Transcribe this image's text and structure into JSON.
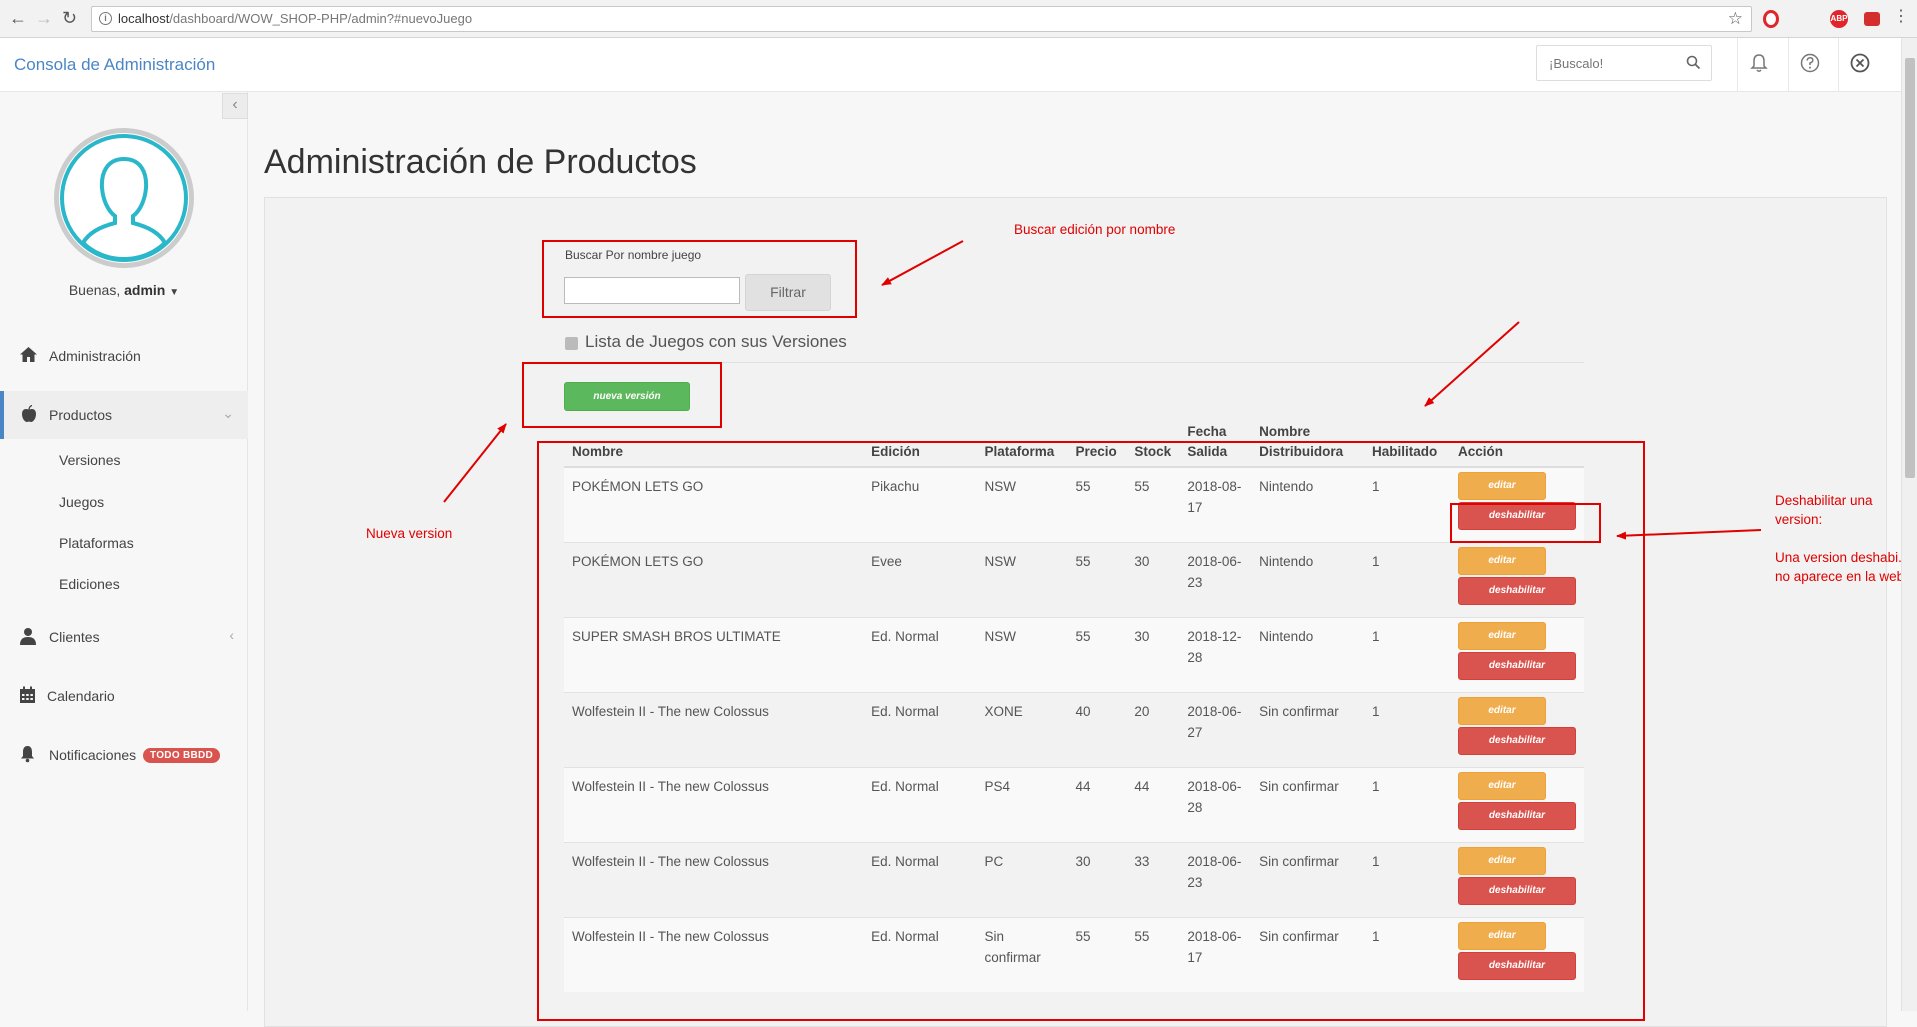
{
  "browser": {
    "url_host": "localhost",
    "url_path": "/dashboard/WOW_SHOP-PHP/admin?#nuevoJuego"
  },
  "header": {
    "brand": "Consola de Administración",
    "search_placeholder": "¡Buscalo!"
  },
  "sidebar": {
    "greeting_prefix": "Buenas,",
    "username": "admin",
    "items": [
      {
        "label": "Administración",
        "icon": "home-icon"
      },
      {
        "label": "Productos",
        "icon": "apple-icon"
      },
      {
        "label": "Clientes",
        "icon": "user-icon"
      },
      {
        "label": "Calendario",
        "icon": "calendar-icon"
      },
      {
        "label": "Notificaciones",
        "icon": "bell-icon",
        "badge": "TODO BBDD"
      }
    ],
    "submenu": [
      "Versiones",
      "Juegos",
      "Plataformas",
      "Ediciones"
    ]
  },
  "main": {
    "title": "Administración de Productos",
    "filter": {
      "label": "Buscar Por nombre juego",
      "button": "Filtrar"
    },
    "list_title": "Lista de Juegos con sus Versiones",
    "new_button": "nueva versión",
    "table": {
      "headers": [
        "Nombre",
        "Edición",
        "Plataforma",
        "Precio",
        "Stock",
        "Fecha Salida",
        "Nombre Distribuidora",
        "Habilitado",
        "Acción"
      ],
      "rows": [
        [
          "POKÉMON LETS GO",
          "Pikachu",
          "NSW",
          "55",
          "55",
          "2018-08-17",
          "Nintendo",
          "1"
        ],
        [
          "POKÉMON LETS GO",
          "Evee",
          "NSW",
          "55",
          "30",
          "2018-06-23",
          "Nintendo",
          "1"
        ],
        [
          "SUPER SMASH BROS ULTIMATE",
          "Ed. Normal",
          "NSW",
          "55",
          "30",
          "2018-12-28",
          "Nintendo",
          "1"
        ],
        [
          "Wolfestein II - The new Colossus",
          "Ed. Normal",
          "XONE",
          "40",
          "20",
          "2018-06-27",
          "Sin confirmar",
          "1"
        ],
        [
          "Wolfestein II - The new Colossus",
          "Ed. Normal",
          "PS4",
          "44",
          "44",
          "2018-06-28",
          "Sin confirmar",
          "1"
        ],
        [
          "Wolfestein II - The new Colossus",
          "Ed. Normal",
          "PC",
          "30",
          "33",
          "2018-06-23",
          "Sin confirmar",
          "1"
        ],
        [
          "Wolfestein II - The new Colossus",
          "Ed. Normal",
          "Sin confirmar",
          "55",
          "55",
          "2018-06-17",
          "Sin confirmar",
          "1"
        ]
      ],
      "edit_label": "editar",
      "disable_label": "deshabilitar"
    }
  },
  "annotations": {
    "search": "Buscar edición por nombre",
    "new_version": "Nueva version",
    "disable_1": "Deshabilitar una",
    "disable_2": "version:",
    "disable_3": "Una version deshabi.",
    "disable_4": "no aparece en la web"
  },
  "colors": {
    "brand": "#4a86c5",
    "success": "#5cb85c",
    "warning": "#f0ad4e",
    "danger": "#d9534f",
    "annotation": "#e00000"
  }
}
